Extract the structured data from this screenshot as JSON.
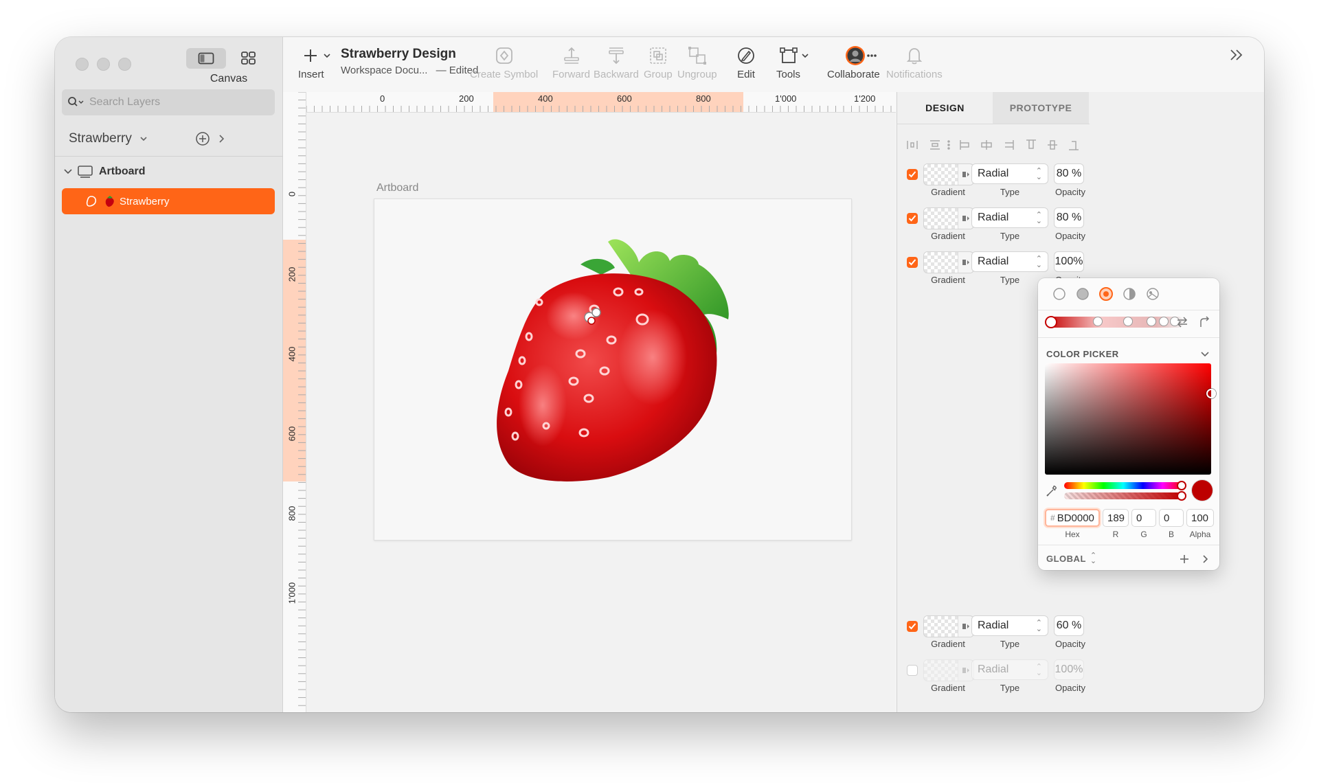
{
  "sidebar": {
    "canvas_label": "Canvas",
    "search_placeholder": "Search Layers",
    "page_name": "Strawberry",
    "artboard_name": "Artboard",
    "layer_name": "Strawberry"
  },
  "toolbar": {
    "insert": "Insert",
    "doc_title": "Strawberry Design",
    "doc_subtitle": "Workspace Docu...",
    "doc_status": "— Edited",
    "create_symbol": "Create Symbol",
    "forward": "Forward",
    "backward": "Backward",
    "group": "Group",
    "ungroup": "Ungroup",
    "edit": "Edit",
    "tools": "Tools",
    "collaborate": "Collaborate",
    "notifications": "Notifications"
  },
  "ruler": {
    "top_ticks": [
      "0",
      "200",
      "400",
      "600",
      "800",
      "1'000",
      "1'200"
    ],
    "left_ticks": [
      "0",
      "200",
      "400",
      "600",
      "800",
      "1'000"
    ]
  },
  "canvas": {
    "artboard_label": "Artboard"
  },
  "inspector": {
    "tabs": {
      "design": "DESIGN",
      "prototype": "PROTOTYPE"
    },
    "fills": [
      {
        "type": "Radial",
        "opacity": "80 %",
        "enabled": true
      },
      {
        "type": "Radial",
        "opacity": "80 %",
        "enabled": true
      },
      {
        "type": "Radial",
        "opacity": "100%",
        "enabled": true
      },
      {
        "type": "Radial",
        "opacity": "60 %",
        "enabled": true
      },
      {
        "type": "Radial",
        "opacity": "100%",
        "enabled": false
      }
    ],
    "labels": {
      "gradient": "Gradient",
      "type": "Type",
      "opacity": "Opacity"
    }
  },
  "color_picker": {
    "title": "COLOR PICKER",
    "hex": "BD0000",
    "hex_prefix": "#",
    "r": "189",
    "g": "0",
    "b": "0",
    "alpha": "100",
    "labels": {
      "hex": "Hex",
      "r": "R",
      "g": "G",
      "b": "B",
      "alpha": "Alpha"
    },
    "global_label": "GLOBAL",
    "current_color": "#BD0000"
  },
  "colors": {
    "accent": "#FF6517",
    "highlight_ruler": "#FFD3BD"
  }
}
